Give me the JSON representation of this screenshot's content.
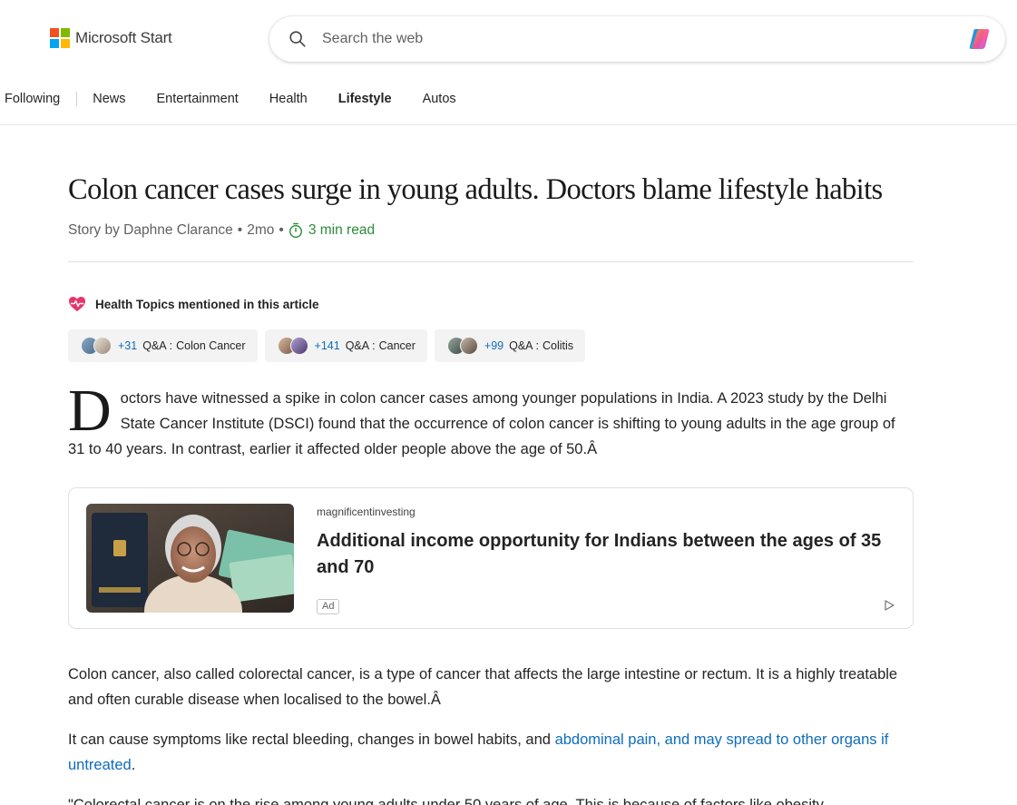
{
  "header": {
    "logo_text": "Microsoft Start",
    "search_placeholder": "Search the web"
  },
  "nav": {
    "items": [
      {
        "label": "Following"
      },
      {
        "label": "News"
      },
      {
        "label": "Entertainment"
      },
      {
        "label": "Health"
      },
      {
        "label": "Lifestyle",
        "active": true
      },
      {
        "label": "Autos"
      }
    ]
  },
  "article": {
    "title": "Colon cancer cases surge in young adults. Doctors blame lifestyle habits",
    "byline": {
      "author": "Story by Daphne Clarance",
      "age": "2mo",
      "separator": "•",
      "read_time": "3 min read"
    },
    "health_topics": {
      "heading": "Health Topics mentioned in this article",
      "chips": [
        {
          "count": "+31",
          "type": "Q&A",
          "topic": "Colon Cancer"
        },
        {
          "count": "+141",
          "type": "Q&A",
          "topic": "Cancer"
        },
        {
          "count": "+99",
          "type": "Q&A",
          "topic": "Colitis"
        }
      ],
      "chip_colon": ":"
    },
    "lead": {
      "dropcap": "D",
      "text": "octors have witnessed a spike in colon cancer cases among younger populations in India. A 2023 study by the Delhi State Cancer Institute (DSCI) found that the occurrence of colon cancer is shifting to young adults in the age group of 31 to 40 years. In contrast, earlier it affected older people above the age of 50.Â"
    },
    "ad": {
      "source": "magnificentinvesting",
      "title": "Additional income opportunity for Indians between the ages of 35 and 70",
      "badge": "Ad"
    },
    "paragraphs": {
      "p1": "Colon cancer, also called colorectal cancer, is a type of cancer that affects the large intestine or rectum. It is a highly treatable and often curable disease when localised to the bowel.Â",
      "p2_before": "It can cause symptoms like rectal bleeding, changes in bowel habits, and ",
      "p2_link": "abdominal pain, and may spread to other organs if untreated",
      "p2_after": ".",
      "p3": "\"Colorectal cancer is on the rise among young adults under 50 years of age. This is because of factors like obesity,"
    }
  },
  "colors": {
    "accent_link": "#0f6cbd",
    "read_time_green": "#2c8b3a",
    "ms_red": "#f25022",
    "ms_green": "#7fba00",
    "ms_blue": "#00a4ef",
    "ms_yellow": "#ffb900"
  },
  "icons": {
    "search": "search-icon",
    "copilot": "copilot-icon",
    "timer": "timer-icon",
    "health": "heart-pulse-icon",
    "ad_choices": "ad-choices-icon"
  }
}
